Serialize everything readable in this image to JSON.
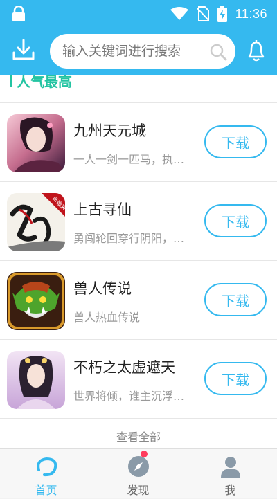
{
  "status": {
    "time": "11:36"
  },
  "header": {
    "search_placeholder": "输入关键词进行搜索"
  },
  "section": {
    "title": "人气最高"
  },
  "games": [
    {
      "name": "九州天元城",
      "desc": "一人一剑一匹马，执…",
      "button": "下载"
    },
    {
      "name": "上古寻仙",
      "desc": "勇闯轮回穿行阴阳，…",
      "button": "下载",
      "badge": "新服来"
    },
    {
      "name": "兽人传说",
      "desc": "兽人热血传说",
      "button": "下载"
    },
    {
      "name": "不朽之太虚遮天",
      "desc": "世界将倾，谁主沉浮…",
      "button": "下载"
    }
  ],
  "see_all": "查看全部",
  "tabs": [
    {
      "label": "首页",
      "icon": "home-icon",
      "active": true
    },
    {
      "label": "发现",
      "icon": "compass-icon",
      "active": false,
      "dot": true
    },
    {
      "label": "我",
      "icon": "user-icon",
      "active": false
    }
  ],
  "colors": {
    "accent": "#35b9ef",
    "section": "#23c4a2",
    "dot": "#ff3b5c"
  }
}
